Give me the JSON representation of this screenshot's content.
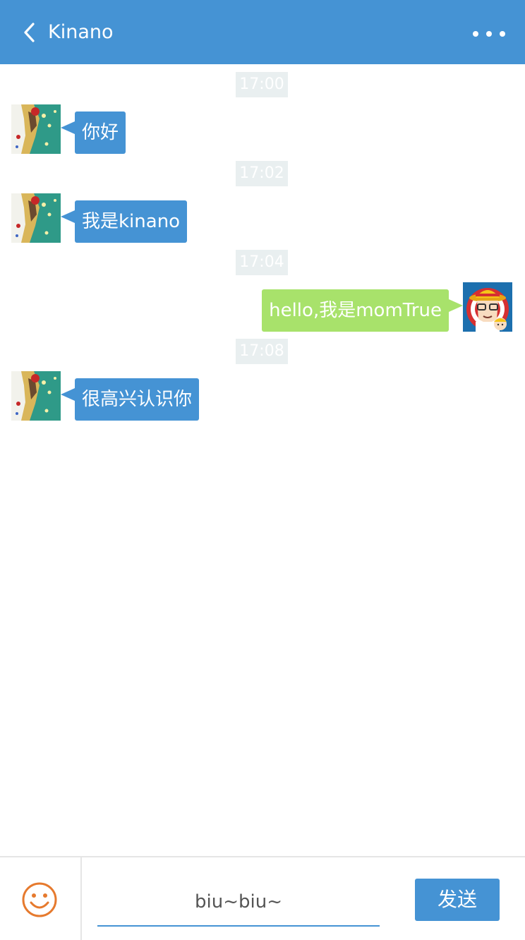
{
  "header": {
    "title": "Kinano",
    "back_icon": "chevron-left-icon",
    "more_icon": "more-dots-icon"
  },
  "messages": [
    {
      "time": "17:00",
      "text": "你好",
      "side": "left"
    },
    {
      "time": "17:02",
      "text": "我是kinano",
      "side": "left"
    },
    {
      "time": "17:04",
      "text": "hello,我是momTrue",
      "side": "right"
    },
    {
      "time": "17:08",
      "text": "很高兴认识你",
      "side": "left"
    }
  ],
  "footer": {
    "emoji_icon": "smiley-icon",
    "input_value": "biu~biu~",
    "send_label": "发送"
  },
  "colors": {
    "primary": "#4593d4",
    "self_bubble": "#a8e26b",
    "time_badge": "#e9eff0",
    "emoji": "#e67a2e"
  }
}
